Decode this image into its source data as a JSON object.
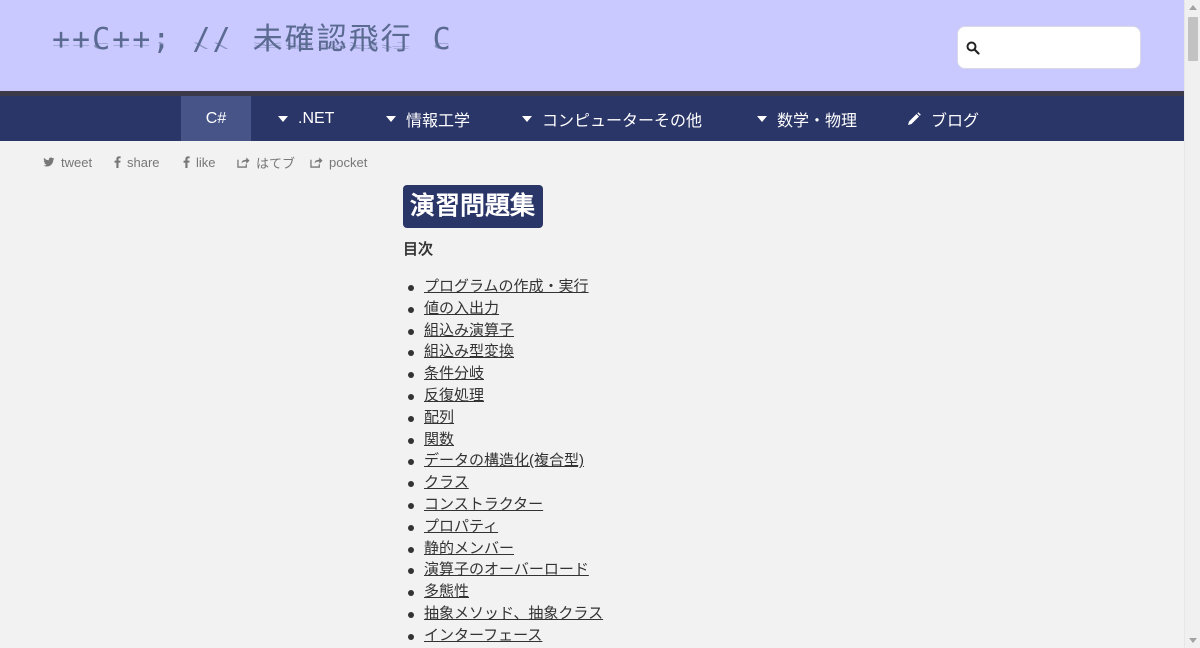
{
  "header": {
    "logo_text": "++C++; // 未確認飛行 C",
    "search": {
      "value": "",
      "placeholder": ""
    }
  },
  "nav": {
    "items": [
      {
        "label": "C#",
        "active": true
      },
      {
        "label": ".NET",
        "icon": "caret-down-icon"
      },
      {
        "label": "情報工学",
        "icon": "caret-down-icon"
      },
      {
        "label": "コンピューターその他",
        "icon": "caret-down-icon"
      },
      {
        "label": "数学・物理",
        "icon": "caret-down-icon"
      },
      {
        "label": "ブログ",
        "icon": "pencil-icon"
      }
    ]
  },
  "share": {
    "items": [
      {
        "label": "tweet",
        "icon": "twitter-icon"
      },
      {
        "label": "share",
        "icon": "facebook-icon"
      },
      {
        "label": "like",
        "icon": "facebook-icon"
      },
      {
        "label": "はてブ",
        "icon": "share-icon"
      },
      {
        "label": "pocket",
        "icon": "share-icon"
      }
    ]
  },
  "content": {
    "title": "演習問題集",
    "toc_heading": "目次",
    "toc": [
      "プログラムの作成・実行",
      "値の入出力",
      "組込み演算子",
      "組込み型変換",
      "条件分岐",
      "反復処理",
      "配列",
      "関数",
      "データの構造化(複合型)",
      "クラス",
      "コンストラクター",
      "プロパティ",
      "静的メンバー",
      "演算子のオーバーロード",
      "多態性",
      "抽象メソッド、抽象クラス",
      "インターフェース"
    ]
  },
  "colors": {
    "header_bg": "#c9c9ff",
    "nav_bg": "#2b3668",
    "nav_active_bg": "#465487",
    "page_bg": "#f2f2f2"
  }
}
